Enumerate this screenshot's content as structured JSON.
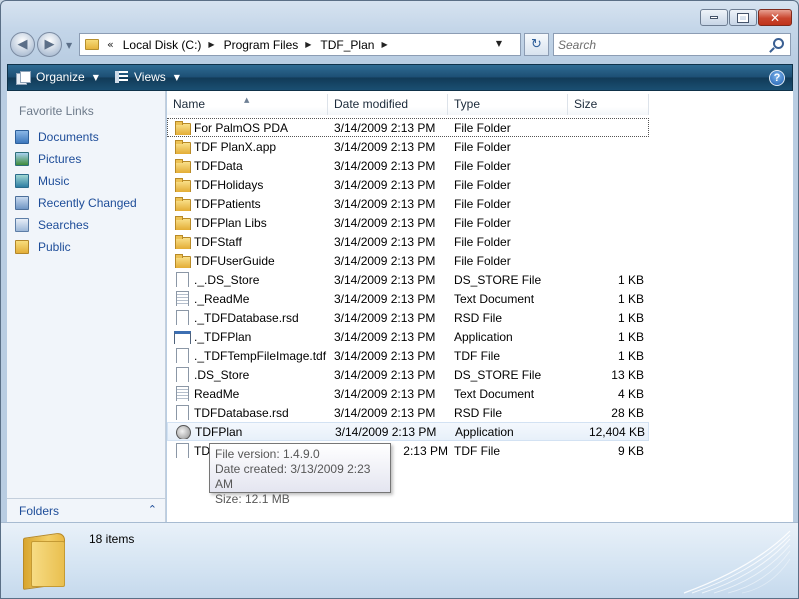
{
  "window": {
    "controls": {
      "minimize_icon": "minimize-icon",
      "maximize_icon": "maximize-icon",
      "close_icon": "close-icon",
      "close_glyph": "✕"
    }
  },
  "address": {
    "overflow": "«",
    "breadcrumbs": [
      {
        "label": "Local Disk (C:)"
      },
      {
        "label": "Program Files"
      },
      {
        "label": "TDF_Plan"
      }
    ],
    "search_placeholder": "Search"
  },
  "toolbar": {
    "organize_label": "Organize",
    "views_label": "Views",
    "help_glyph": "?"
  },
  "navigation": {
    "heading": "Favorite Links",
    "links": [
      {
        "label": "Documents",
        "icon": "documents-icon"
      },
      {
        "label": "Pictures",
        "icon": "pictures-icon"
      },
      {
        "label": "Music",
        "icon": "music-icon"
      },
      {
        "label": "Recently Changed",
        "icon": "recently-changed-icon"
      },
      {
        "label": "Searches",
        "icon": "searches-icon"
      },
      {
        "label": "Public",
        "icon": "public-folder-icon"
      }
    ],
    "folders_label": "Folders"
  },
  "file_list": {
    "columns": [
      "Name",
      "Date modified",
      "Type",
      "Size"
    ],
    "sorted_by": "Name",
    "rows": [
      {
        "name": "For PalmOS PDA",
        "date": "3/14/2009 2:13 PM",
        "type": "File Folder",
        "size": "",
        "icon": "folder-icon"
      },
      {
        "name": "TDF PlanX.app",
        "date": "3/14/2009 2:13 PM",
        "type": "File Folder",
        "size": "",
        "icon": "folder-icon"
      },
      {
        "name": "TDFData",
        "date": "3/14/2009 2:13 PM",
        "type": "File Folder",
        "size": "",
        "icon": "folder-icon"
      },
      {
        "name": "TDFHolidays",
        "date": "3/14/2009 2:13 PM",
        "type": "File Folder",
        "size": "",
        "icon": "folder-icon"
      },
      {
        "name": "TDFPatients",
        "date": "3/14/2009 2:13 PM",
        "type": "File Folder",
        "size": "",
        "icon": "folder-icon"
      },
      {
        "name": "TDFPlan Libs",
        "date": "3/14/2009 2:13 PM",
        "type": "File Folder",
        "size": "",
        "icon": "folder-icon"
      },
      {
        "name": "TDFStaff",
        "date": "3/14/2009 2:13 PM",
        "type": "File Folder",
        "size": "",
        "icon": "folder-icon"
      },
      {
        "name": "TDFUserGuide",
        "date": "3/14/2009 2:13 PM",
        "type": "File Folder",
        "size": "",
        "icon": "folder-icon"
      },
      {
        "name": "._.DS_Store",
        "date": "3/14/2009 2:13 PM",
        "type": "DS_STORE File",
        "size": "1 KB",
        "icon": "blank-file-icon"
      },
      {
        "name": "._ReadMe",
        "date": "3/14/2009 2:13 PM",
        "type": "Text Document",
        "size": "1 KB",
        "icon": "text-document-icon"
      },
      {
        "name": "._TDFDatabase.rsd",
        "date": "3/14/2009 2:13 PM",
        "type": "RSD File",
        "size": "1 KB",
        "icon": "blank-file-icon"
      },
      {
        "name": "._TDFPlan",
        "date": "3/14/2009 2:13 PM",
        "type": "Application",
        "size": "1 KB",
        "icon": "application-icon"
      },
      {
        "name": "._TDFTempFileImage.tdf",
        "date": "3/14/2009 2:13 PM",
        "type": "TDF File",
        "size": "1 KB",
        "icon": "blank-file-icon"
      },
      {
        "name": ".DS_Store",
        "date": "3/14/2009 2:13 PM",
        "type": "DS_STORE File",
        "size": "13 KB",
        "icon": "blank-file-icon"
      },
      {
        "name": "ReadMe",
        "date": "3/14/2009 2:13 PM",
        "type": "Text Document",
        "size": "4 KB",
        "icon": "text-document-icon"
      },
      {
        "name": "TDFDatabase.rsd",
        "date": "3/14/2009 2:13 PM",
        "type": "RSD File",
        "size": "28 KB",
        "icon": "blank-file-icon"
      },
      {
        "name": "TDFPlan",
        "date": "3/14/2009 2:13 PM",
        "type": "Application",
        "size": "12,404 KB",
        "icon": "tdfplan-app-icon"
      },
      {
        "name": "TD",
        "date": "2:13 PM",
        "type": "TDF File",
        "size": "9 KB",
        "icon": "blank-file-icon"
      }
    ]
  },
  "tooltip": {
    "lines": [
      "File version: 1.4.9.0",
      "Date created: 3/13/2009 2:23 AM",
      "Size: 12.1 MB"
    ]
  },
  "details": {
    "item_count": "18 items"
  }
}
